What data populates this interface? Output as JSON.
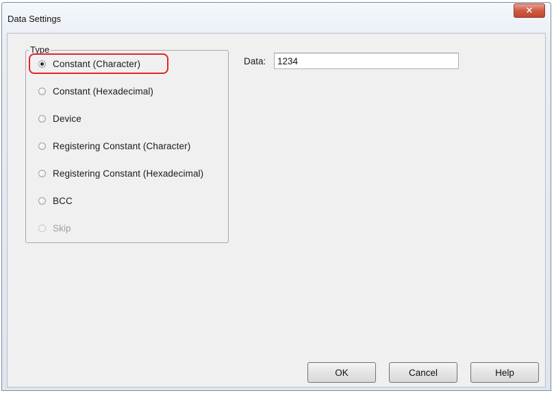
{
  "window": {
    "title": "Data Settings",
    "close_glyph": "×"
  },
  "type_group": {
    "legend": "Type",
    "options": [
      {
        "label": "Constant (Character)",
        "checked": true,
        "enabled": true
      },
      {
        "label": "Constant (Hexadecimal)",
        "checked": false,
        "enabled": true
      },
      {
        "label": "Device",
        "checked": false,
        "enabled": true
      },
      {
        "label": "Registering Constant (Character)",
        "checked": false,
        "enabled": true
      },
      {
        "label": "Registering Constant (Hexadecimal)",
        "checked": false,
        "enabled": true
      },
      {
        "label": "BCC",
        "checked": false,
        "enabled": true
      },
      {
        "label": "Skip",
        "checked": false,
        "enabled": false
      }
    ]
  },
  "data_field": {
    "label": "Data:",
    "value": "1234"
  },
  "buttons": {
    "ok": "OK",
    "cancel": "Cancel",
    "help": "Help"
  },
  "colors": {
    "highlight": "#e0212b",
    "close_button": "#c24631"
  }
}
